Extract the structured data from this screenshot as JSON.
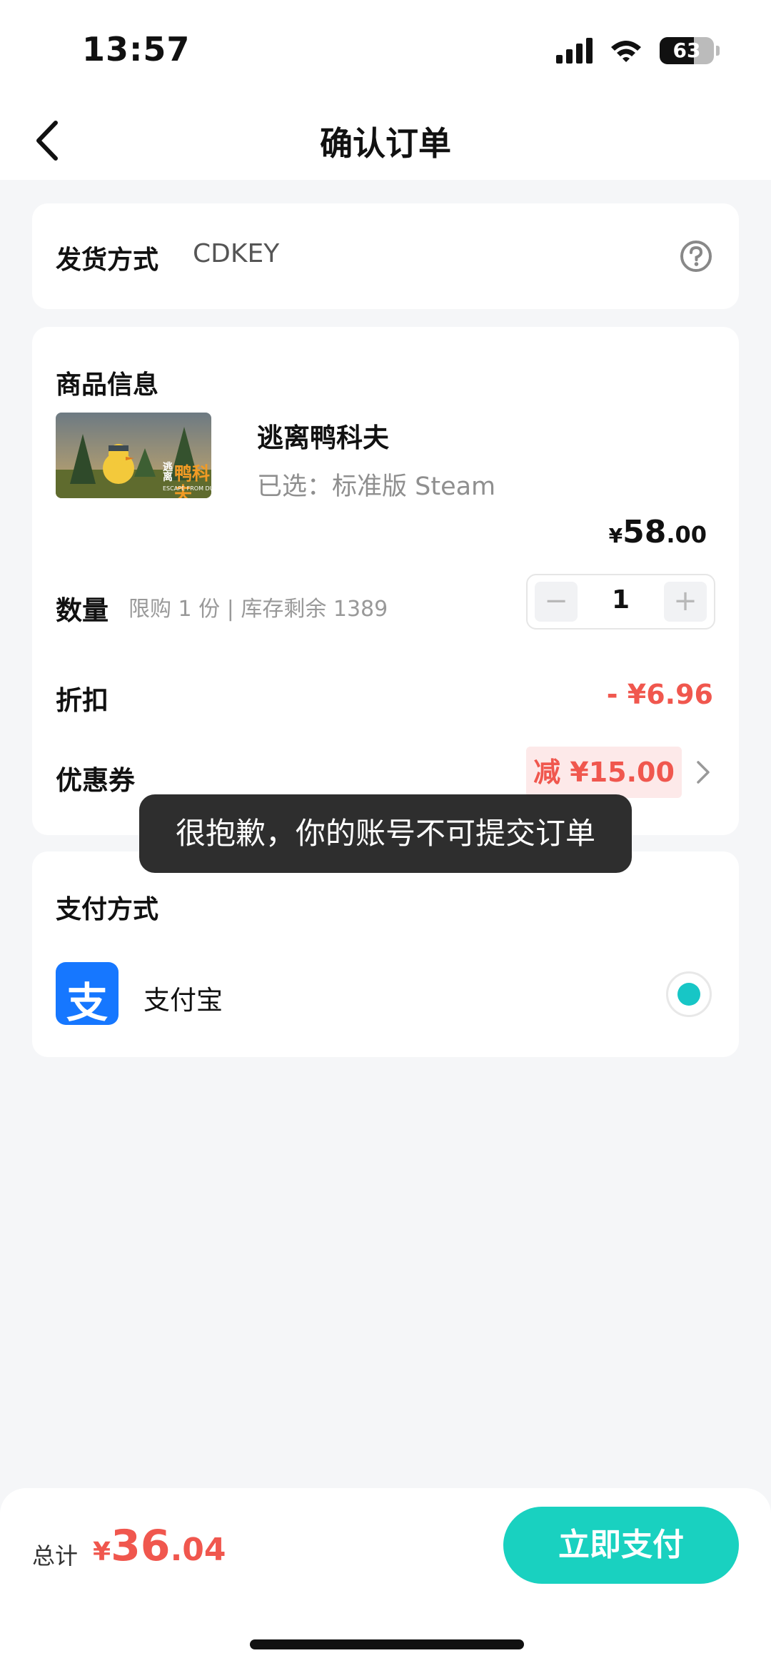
{
  "status_bar": {
    "time": "13:57",
    "battery": "63",
    "battery_level": 0.63
  },
  "nav": {
    "title": "确认订单"
  },
  "delivery": {
    "label": "发货方式",
    "value": "CDKEY"
  },
  "product": {
    "section_title": "商品信息",
    "name": "逃离鸭科夫",
    "variant": "已选：标准版 Steam",
    "price_currency": "¥",
    "price_integer": "58",
    "price_decimal": ".00",
    "image_title_line1": "逃",
    "image_title_line2": "离",
    "image_title_main": "鸭科夫",
    "image_subtitle": "ESCAPE FROM DUCKOV",
    "quantity_label": "数量",
    "quantity_limit": "限购 1 份 | 库存剩余 1389",
    "quantity_value": "1",
    "minus_symbol": "−",
    "plus_symbol": "+",
    "discount_label": "折扣",
    "discount_value": "- ¥6.96",
    "coupon_label": "优惠券",
    "coupon_value": "减 ¥15.00"
  },
  "toast": {
    "message": "很抱歉，你的账号不可提交订单"
  },
  "payment": {
    "section_title": "支付方式",
    "method_name": "支付宝",
    "method_logo_char": "支"
  },
  "footer": {
    "total_label": "总计",
    "total_currency": "¥",
    "total_integer": "36",
    "total_decimal": ".04",
    "pay_button": "立即支付"
  },
  "colors": {
    "accent": "#19d1c0",
    "price_red": "#f0574e",
    "alipay_blue": "#1677ff"
  }
}
